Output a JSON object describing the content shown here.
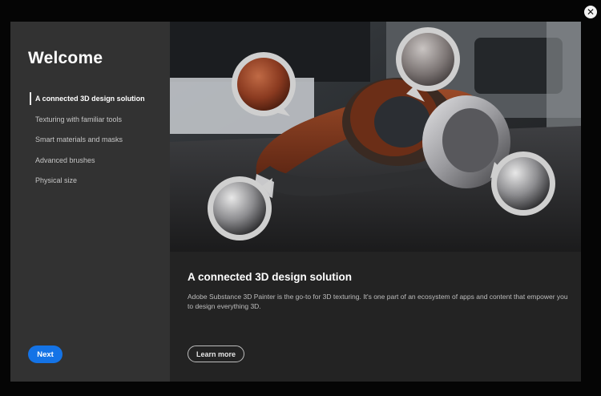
{
  "close": {
    "icon": "close-icon",
    "glyph": "✕"
  },
  "sidebar": {
    "title": "Welcome",
    "items": [
      {
        "label": "A connected 3D design solution",
        "active": true
      },
      {
        "label": "Texturing with familiar tools",
        "active": false
      },
      {
        "label": "Smart materials and masks",
        "active": false
      },
      {
        "label": "Advanced brushes",
        "active": false
      },
      {
        "label": "Physical size",
        "active": false
      }
    ],
    "next_label": "Next"
  },
  "main": {
    "title": "A connected 3D design solution",
    "description": "Adobe Substance 3D Painter is the go-to for 3D texturing. It's one part of an ecosystem of apps and content that empower you to design everything 3D.",
    "learn_more_label": "Learn more"
  },
  "colors": {
    "accent": "#1473e6",
    "sidebar_bg": "#323232",
    "panel_bg": "#232323",
    "page_bg": "#050505"
  }
}
